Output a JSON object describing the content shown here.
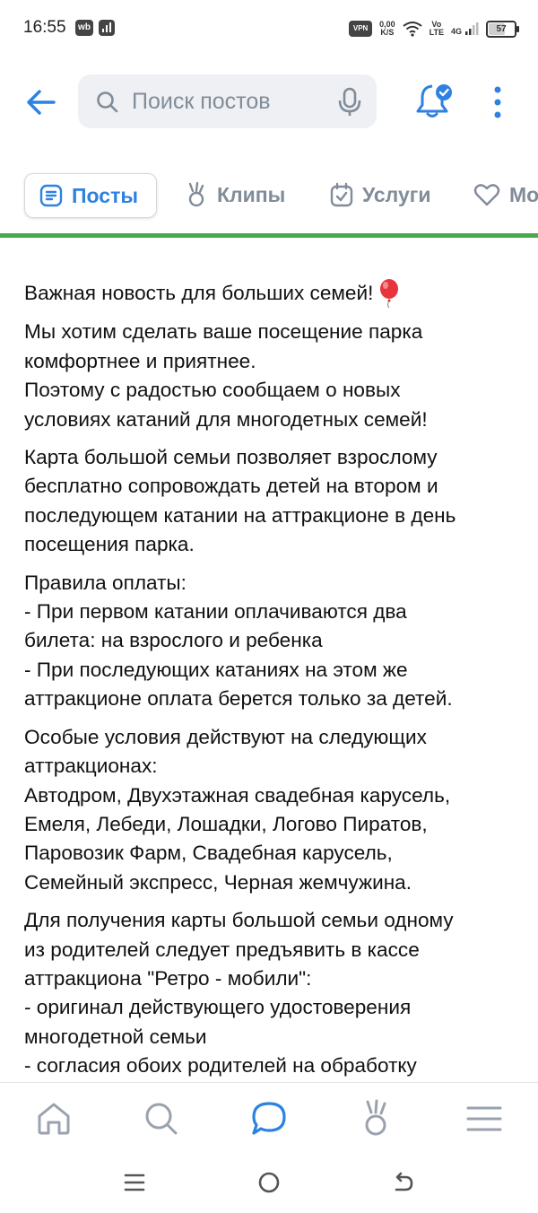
{
  "status_bar": {
    "time": "16:55",
    "wb_badge": "wb",
    "vpn": "VPN",
    "net_speed_value": "0,00",
    "net_speed_unit": "K/S",
    "volte_top": "Vo",
    "volte_bottom": "LTE",
    "network": "4G",
    "battery": "57"
  },
  "search": {
    "placeholder": "Поиск постов"
  },
  "tabs": [
    {
      "label": "Посты",
      "icon": "posts-icon",
      "active": true
    },
    {
      "label": "Клипы",
      "icon": "clips-icon",
      "active": false
    },
    {
      "label": "Услуги",
      "icon": "services-icon",
      "active": false
    },
    {
      "label": "Мо",
      "icon": "heart-icon",
      "active": false
    }
  ],
  "post": {
    "title": "Важная новость для больших семей!",
    "title_icon": "balloon-icon",
    "paragraphs": [
      "Мы хотим сделать ваше посещение парка\nкомфортнее и приятнее.\nПоэтому с радостью сообщаем о новых\nусловиях катаний для многодетных семей!",
      "Карта большой семьи позволяет взрослому\nбесплатно сопровождать детей на втором и\nпоследующем катании на аттракционе в день\nпосещения парка.",
      "Правила оплаты:\n- При первом катании оплачиваются два\nбилета: на взрослого и ребенка\n- При последующих катаниях на этом же\nаттракционе оплата берется только за детей.",
      "Особые условия действуют на следующих\nаттракционах:\nАвтодром, Двухэтажная свадебная карусель,\nЕмеля, Лебеди, Лошадки, Логово Пиратов,\nПаровозик Фарм, Свадебная карусель,\nСемейный экспресс, Черная жемчужина.",
      "Для получения карты большой семьи одному\nиз родителей следует предъявить в кассе\nаттракциона \"Ретро - мобили\":\n- оригинал действующего удостоверения\nмногодетной семьи\n- согласия обоих родителей на обработку"
    ]
  },
  "bottom_nav": [
    {
      "icon": "home-icon"
    },
    {
      "icon": "search-icon"
    },
    {
      "icon": "messages-icon",
      "active": true
    },
    {
      "icon": "clips-icon"
    },
    {
      "icon": "menu-icon"
    }
  ],
  "colors": {
    "accent": "#2d81e0",
    "inactive": "#818c99",
    "divider": "#4ca84c",
    "balloon": "#e8343c"
  }
}
